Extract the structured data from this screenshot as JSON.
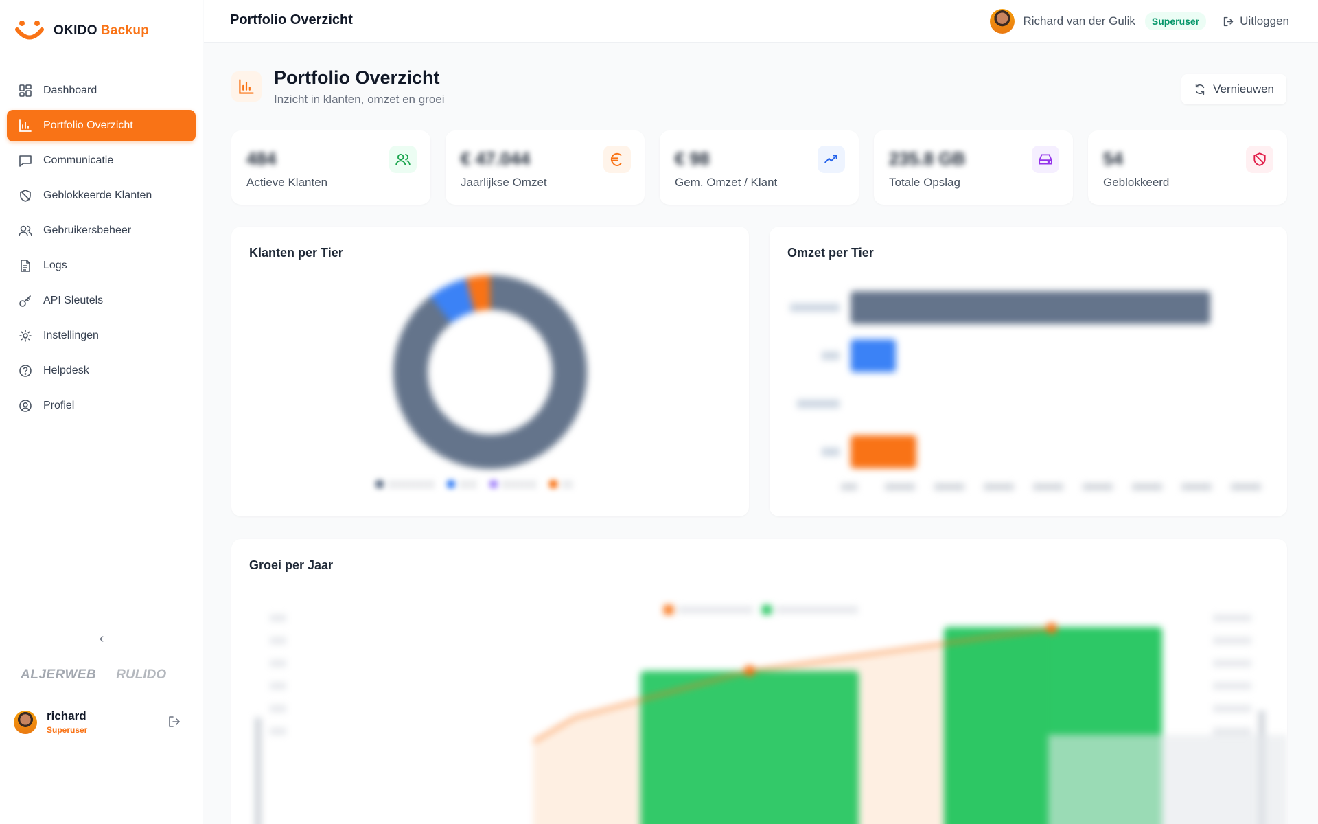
{
  "brand": {
    "name": "OKIDO",
    "accent": "Backup",
    "color": "#f97316"
  },
  "nav": {
    "items": [
      {
        "label": "Dashboard",
        "icon": "dashboard-grid-icon"
      },
      {
        "label": "Portfolio Overzicht",
        "icon": "bar-chart-icon",
        "active": true
      },
      {
        "label": "Communicatie",
        "icon": "chat-icon"
      },
      {
        "label": "Geblokkeerde Klanten",
        "icon": "shield-off-icon"
      },
      {
        "label": "Gebruikersbeheer",
        "icon": "users-icon"
      },
      {
        "label": "Logs",
        "icon": "document-icon"
      },
      {
        "label": "API Sleutels",
        "icon": "key-icon"
      },
      {
        "label": "Instellingen",
        "icon": "gear-icon"
      },
      {
        "label": "Helpdesk",
        "icon": "help-circle-icon"
      },
      {
        "label": "Profiel",
        "icon": "user-circle-icon"
      }
    ],
    "collapse_icon": "chevron-left-icon"
  },
  "partners": {
    "a": "ALJERWEB",
    "b": "RULIDO"
  },
  "sidebar_user": {
    "name": "richard",
    "role": "Superuser"
  },
  "topbar": {
    "title": "Portfolio Overzicht",
    "user_name": "Richard van der Gulik",
    "role": "Superuser",
    "logout_label": "Uitloggen"
  },
  "page": {
    "title": "Portfolio Overzicht",
    "subtitle": "Inzicht in klanten, omzet en groei",
    "refresh_label": "Vernieuwen"
  },
  "stats": [
    {
      "label": "Actieve Klanten",
      "value": "484",
      "icon": "users-icon",
      "color": "#16a34a",
      "bg": "#ecfdf3"
    },
    {
      "label": "Jaarlijkse Omzet",
      "value": "€ 47.044",
      "icon": "euro-icon",
      "color": "#f97316",
      "bg": "#fff4ea"
    },
    {
      "label": "Gem. Omzet / Klant",
      "value": "€ 98",
      "icon": "trending-up-icon",
      "color": "#2563eb",
      "bg": "#eef4ff"
    },
    {
      "label": "Totale Opslag",
      "value": "235.8 GB",
      "icon": "hard-drive-icon",
      "color": "#9333ea",
      "bg": "#f5efff"
    },
    {
      "label": "Geblokkeerd",
      "value": "54",
      "icon": "shield-off-icon",
      "color": "#e11d48",
      "bg": "#fff0f2"
    }
  ],
  "cards": {
    "donut_title": "Klanten per Tier",
    "bars_title": "Omzet per Tier",
    "growth_title": "Groei per Jaar"
  },
  "colors": {
    "slate": "#64748b",
    "blue": "#3b82f6",
    "purple": "#a78bfa",
    "orange": "#f97316",
    "green": "#22c55e"
  }
}
